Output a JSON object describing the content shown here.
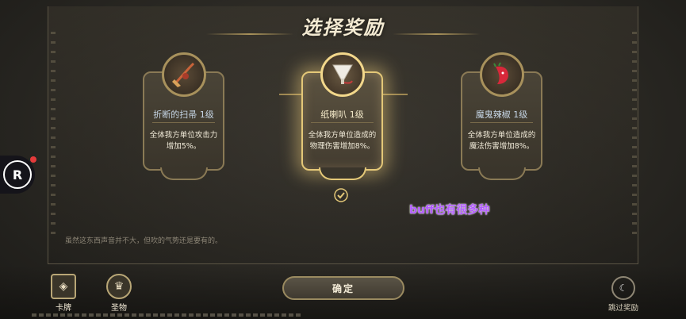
{
  "header": {
    "title": "选择奖励"
  },
  "rewards": [
    {
      "name": "折断的扫帚 1级",
      "description": "全体我方单位攻击力增加5%。",
      "icon": "broken-broom-icon",
      "selected": false
    },
    {
      "name": "纸喇叭 1级",
      "description": "全体我方单位造成的物理伤害增加8%。",
      "icon": "paper-horn-icon",
      "selected": true
    },
    {
      "name": "魔鬼辣椒 1级",
      "description": "全体我方单位造成的魔法伤害增加8%。",
      "icon": "devil-pepper-icon",
      "selected": false
    }
  ],
  "annotation": "buff也有很多种",
  "flavor_text": "虽然这东西声音并不大，但吹的气势还是要有的。",
  "bottom": {
    "cards_label": "卡牌",
    "relics_label": "圣物",
    "confirm_label": "确定",
    "skip_label": "跳过奖励"
  },
  "colors": {
    "accent": "#e4c878",
    "annotation": "#b25bff",
    "badge": "#e53b3b"
  }
}
